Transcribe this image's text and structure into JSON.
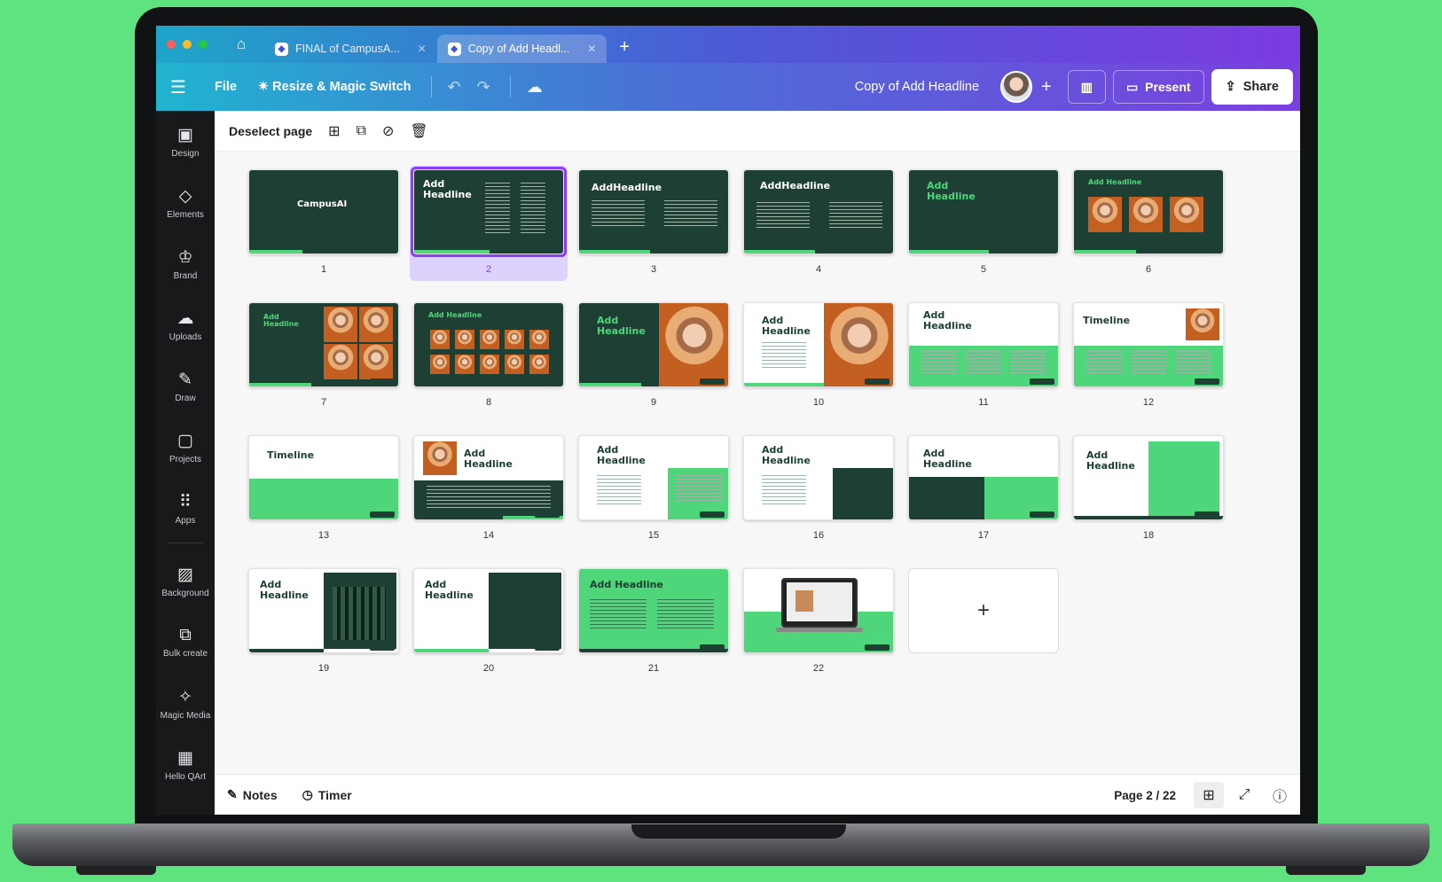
{
  "browser": {
    "tabs": [
      {
        "title": "FINAL of CampusA...",
        "active": false
      },
      {
        "title": "Copy of Add Headl...",
        "active": true
      }
    ],
    "new_tab": "+"
  },
  "toolbar": {
    "file": "File",
    "resize": "Resize & Magic Switch",
    "doc_title": "Copy of Add Headline",
    "present": "Present",
    "share": "Share"
  },
  "sidebar": {
    "items": [
      {
        "label": "Design",
        "icon": "design-icon"
      },
      {
        "label": "Elements",
        "icon": "elements-icon"
      },
      {
        "label": "Brand",
        "icon": "brand-icon"
      },
      {
        "label": "Uploads",
        "icon": "uploads-icon"
      },
      {
        "label": "Draw",
        "icon": "draw-icon"
      },
      {
        "label": "Projects",
        "icon": "projects-icon"
      },
      {
        "label": "Apps",
        "icon": "apps-icon"
      },
      {
        "label": "Background",
        "icon": "background-icon"
      },
      {
        "label": "Bulk create",
        "icon": "bulk-create-icon"
      },
      {
        "label": "Magic Media",
        "icon": "magic-media-icon"
      },
      {
        "label": "Hello QArt",
        "icon": "qr-art-icon"
      }
    ]
  },
  "page_actions": {
    "deselect": "Deselect page"
  },
  "pages": [
    {
      "num": "1",
      "title": "CampusAI"
    },
    {
      "num": "2",
      "title": "Add Headline",
      "selected": true
    },
    {
      "num": "3",
      "title": "AddHeadline"
    },
    {
      "num": "4",
      "title": "AddHeadline"
    },
    {
      "num": "5",
      "title": "Add Headline"
    },
    {
      "num": "6",
      "title": "Add Headline"
    },
    {
      "num": "7",
      "title": "Add Headline"
    },
    {
      "num": "8",
      "title": "Add Headline"
    },
    {
      "num": "9",
      "title": "Add Headline"
    },
    {
      "num": "10",
      "title": "Add Headline"
    },
    {
      "num": "11",
      "title": "Add Headline"
    },
    {
      "num": "12",
      "title": "Timeline"
    },
    {
      "num": "13",
      "title": "Timeline"
    },
    {
      "num": "14",
      "title": "Add Headline"
    },
    {
      "num": "15",
      "title": "Add Headline"
    },
    {
      "num": "16",
      "title": "Add Headline"
    },
    {
      "num": "17",
      "title": "Add Headline"
    },
    {
      "num": "18",
      "title": "Add Headline"
    },
    {
      "num": "19",
      "title": "Add Headline"
    },
    {
      "num": "20",
      "title": "Add Headline"
    },
    {
      "num": "21",
      "title": "Add Headline"
    },
    {
      "num": "22",
      "title": ""
    }
  ],
  "add_page": "+",
  "footer": {
    "notes": "Notes",
    "timer": "Timer",
    "page_indicator": "Page 2 / 22"
  },
  "colors": {
    "background": "#5ee37f",
    "slide_dark": "#1e4034",
    "slide_green": "#4fd57a",
    "selection": "#8b3dff"
  }
}
